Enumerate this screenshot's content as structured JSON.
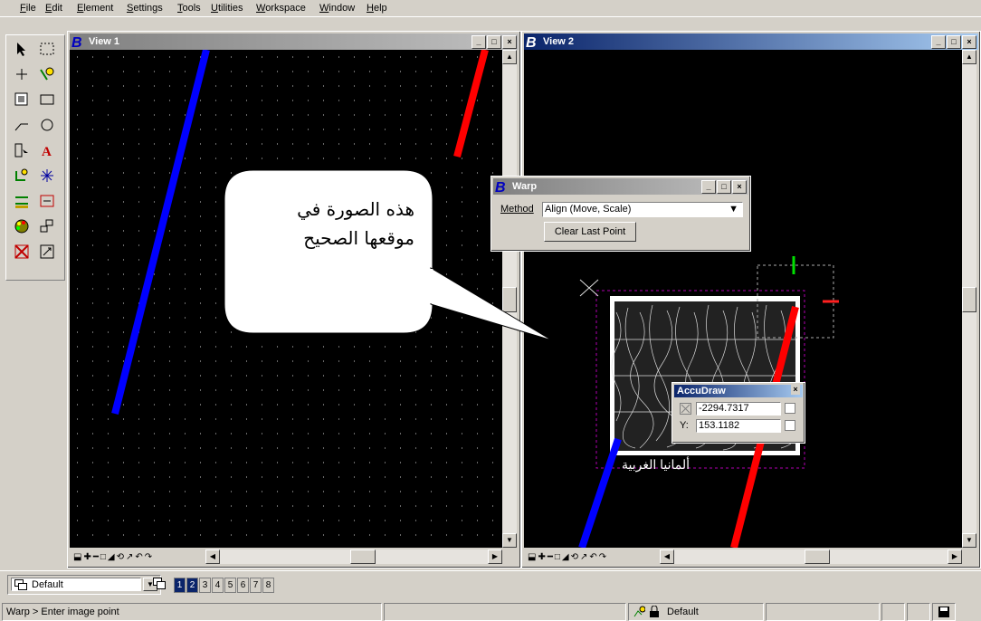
{
  "menu": [
    "File",
    "Edit",
    "Element",
    "Settings",
    "Tools",
    "Utilities",
    "Workspace",
    "Window",
    "Help"
  ],
  "view1": {
    "title": "View 1"
  },
  "view2": {
    "title": "View 2"
  },
  "callout": {
    "line1": "هذه الصورة في",
    "line2": "موقعها الصحيح"
  },
  "warp": {
    "title": "Warp",
    "method_label": "Method",
    "method_value": "Align (Move, Scale)",
    "clear_button": "Clear Last Point"
  },
  "accudraw": {
    "title": "AccuDraw",
    "x_value": "-2294.7317",
    "y_label": "Y:",
    "y_value": "153.1182"
  },
  "levelbar": {
    "level_value": "Default",
    "view_numbers": [
      "1",
      "2",
      "3",
      "4",
      "5",
      "6",
      "7",
      "8"
    ]
  },
  "status": {
    "prompt": "Warp > Enter image point",
    "level": "Default"
  },
  "colors": {
    "blue_line": "#0000ff",
    "red_line": "#ff0000",
    "title_active": "#0a246a",
    "canvas": "#000000"
  }
}
